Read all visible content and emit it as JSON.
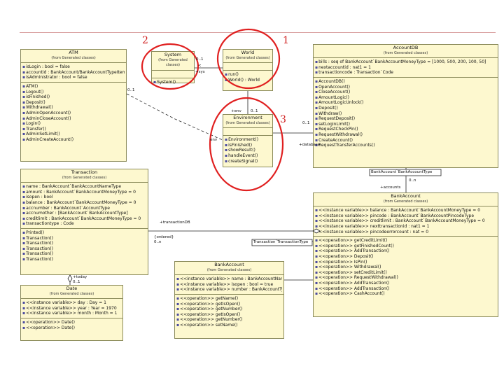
{
  "markers": [
    "2",
    "1",
    "3"
  ],
  "classes": {
    "atm": {
      "name": "ATM",
      "sub": "(from Generated classes)",
      "attrs": [
        "isLogin : bool = false",
        "accountid : BankAccount/BankAccountTypeItem",
        "isAdministrator : bool = false"
      ],
      "ops": [
        "ATM()",
        "Logout()",
        "isFinished()",
        "Deposit()",
        "Withdrawal()",
        "AdminOpenAccount()",
        "AdminCloseAccount()",
        "Login()",
        "Transfer()",
        "AdminSetLimit()",
        "AdminCreateAccount()"
      ]
    },
    "system": {
      "name": "System",
      "sub": "(from Generated classes)",
      "attrs": [],
      "ops": [
        "System()"
      ]
    },
    "world": {
      "name": "World",
      "sub": "(from Generated classes)",
      "attrs": [],
      "ops": [
        "run()",
        "World() : World"
      ]
    },
    "environment": {
      "name": "Environment",
      "sub": "(from Generated classes)",
      "attrs": [],
      "ops": [
        "Environment()",
        "isFinished()",
        "showResult()",
        "handleEvent()",
        "createSignal()"
      ]
    },
    "accountdb": {
      "name": "AccountDB",
      "sub": "(from Generated classes)",
      "attrs": [
        "bills : seq of BankAccount`BankAccountMoneyType = [1000, 500, 200, 100, 50]",
        "nextaccountid : nat1 = 1",
        "transactioncode : Transaction`Code"
      ],
      "ops": [
        "AccountDB()",
        "OpenAccount()",
        "CloseAccount()",
        "AmountLogic()",
        "AmountLogicUnlock()",
        "Deposit()",
        "Withdraw()",
        "RequestDeposit()",
        "setLoginLimit()",
        "RequestCheckPin()",
        "RequestWithdrawal()",
        "CreateAccount()",
        "RequestTransferAccounts()"
      ]
    },
    "transaction": {
      "name": "Transaction",
      "sub": "(from Generated classes)",
      "attrs": [
        "name : BankAccount`BankAccountNameType",
        "amount : BankAccount`BankAccountMoneyType = 0",
        "isopen : bool",
        "balance : BankAccount`BankAccountMoneyType = 0",
        "accnumber : BankAccount`AccountType",
        "accnumother : [BankAccount`BankAccountType]",
        "creditlimit : BankAccount`BankAccountMoneyType = 0",
        "transactiontype : Code"
      ],
      "ops": [
        "Printed()",
        "Transaction()",
        "Transaction()",
        "Transaction()",
        "Transaction()",
        "Transaction()"
      ]
    },
    "date": {
      "name": "Date",
      "sub": "(from Generated classes)",
      "attrs": [
        "<<instance variable>> day : Day = 1",
        "<<instance variable>> year : Year = 1970",
        "<<instance variable>> month : Month = 1"
      ],
      "ops": [
        "<<operation>> Date()",
        "<<operation>> Date()"
      ]
    },
    "bankaccount": {
      "name": "BankAccount",
      "sub": "(from Generated classes)",
      "attrs": [
        "<<instance variable>> name : BankAccountName type",
        "<<instance variable>> isopen : bool = true",
        "<<instance variable>> number : BankAccountType"
      ],
      "ops": [
        "<<operation>> getName()",
        "<<operation>> getIsOpen()",
        "<<operation>> getNumber()",
        "<<operation>> getIsOpen()",
        "<<operation>> getNumber()",
        "<<operation>> setName()"
      ]
    },
    "bankaccountmap": {
      "name": "BankAccount",
      "sub": "(from Generated classes)",
      "attrs": [
        "<<instance variable>> balance : BankAccount`BankAccountMoneyType = 0",
        "<<instance variable>> pincode : BankAccount`BankAccountPincodeType",
        "<<instance variable>> creditlimit : BankAccount`BankAccountMoneyType = 0",
        "<<instance variable>> nexttransactionid : nat1 = 1",
        "<<instance variable>> pincodeerrorcount : nat = 0"
      ],
      "ops": [
        "<<operation>> getCreditLimit()",
        "<<operation>> getFinishedCount()",
        "<<operation>> AddTransaction()",
        "<<operation>> Deposit()",
        "<<operation>> IsPin()",
        "<<operation>> Withdrawal()",
        "<<operation>> setCreditLimit()",
        "<<operation>> RequestWithdrawal()",
        "<<operation>> AddTransaction()",
        "<<operation>> AddTransaction()",
        "<<operation>> CashAccount()"
      ]
    }
  },
  "labels": {
    "l01": "0..1",
    "l02": "<",
    "l03": "+sys",
    "l04": "+env",
    "l05": "0..1",
    "l06": "0..1",
    "l07": "env",
    "l08": "0..1",
    "l09": "+database",
    "l10": "BankAccount`BankAccountType",
    "l11": "+accounts",
    "l12": "0..n",
    "l13": "+transactionDB",
    "l14": "{ordered}",
    "l15": "0..n",
    "l16": "Transaction`TransactionType",
    "l17": "+today",
    "l18": "0..1"
  },
  "colors": {
    "circle": "#e02020",
    "box_fill": "#fdf8cf",
    "box_border": "#8a8a5a"
  }
}
